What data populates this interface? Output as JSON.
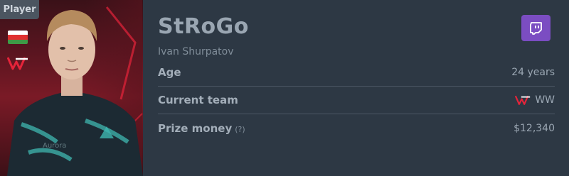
{
  "badge": {
    "label": "Player"
  },
  "flag": {
    "colors": [
      "#ffffff",
      "#e03030",
      "#3e9a46"
    ]
  },
  "player": {
    "nickname": "StRoGo",
    "real_name": "Ivan Shurpatov"
  },
  "twitch": {
    "icon": "twitch-icon",
    "color": "#7b4dc2"
  },
  "stats": [
    {
      "label": "Age",
      "value": "24 years"
    },
    {
      "label": "Current team",
      "value": "WW",
      "icon": "team-logo-icon"
    },
    {
      "label": "Prize money",
      "hint": "(?)",
      "value": "$12,340"
    }
  ]
}
